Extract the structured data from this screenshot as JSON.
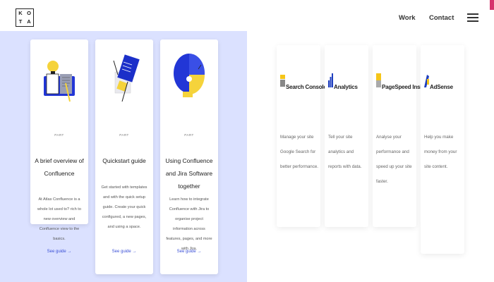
{
  "header": {
    "logo_letters": [
      "K",
      "O",
      "T",
      "A"
    ],
    "nav": {
      "work": "Work",
      "contact": "Contact"
    }
  },
  "guides": [
    {
      "kicker": "PART",
      "title": "A brief overview of Confluence",
      "description": "At Atlas Confluence is a whole lot used to? rich to new overview and Confluence view to the basics.",
      "cta": "See guide →"
    },
    {
      "kicker": "PART",
      "title": "Quickstart guide",
      "description": "Get started with templates and with the quick setup guide. Create your quick configured, a new pages, and using a space.",
      "cta": "See guide →"
    },
    {
      "kicker": "PART",
      "title": "Using Confluence and Jira Software together",
      "description": "Learn how to integrate Confluence with Jira to organise project information across features, pages, and more with Jira.",
      "cta": "See guide →"
    }
  ],
  "integrations": [
    {
      "name": "Search Console",
      "description": "Manage your site Google Search for better performance."
    },
    {
      "name": "Analytics",
      "description": "Tell your site analytics and reports with data."
    },
    {
      "name": "PageSpeed Insights",
      "description": "Analyse your performance and speed up your site faster."
    },
    {
      "name": "AdSense",
      "description": "Help you make money from your site content."
    }
  ],
  "colors": {
    "panel_bg": "#dbe1ff",
    "link": "#3a4fd6",
    "accent": "#d6336c"
  }
}
